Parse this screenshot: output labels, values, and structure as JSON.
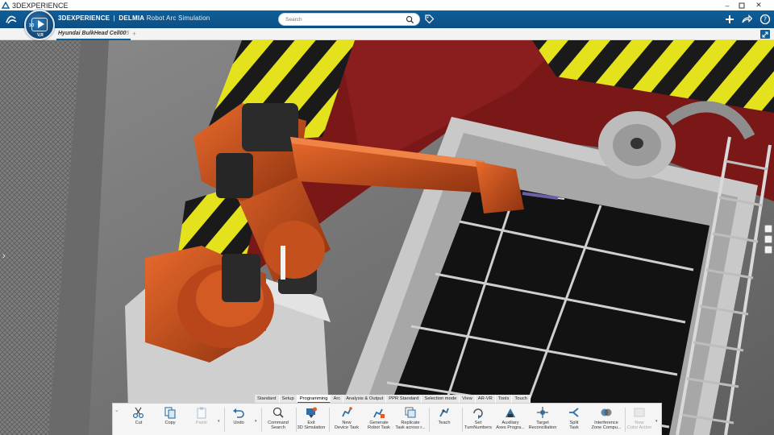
{
  "os_window": {
    "title": "3DEXPERIENCE",
    "controls": [
      "minimize-icon",
      "maximize-icon",
      "close-icon"
    ]
  },
  "header": {
    "brand_prefix": "3D",
    "brand_main": "EXPERIENCE",
    "separator": "|",
    "product": "DELMIA",
    "role": "Robot Arc Simulation",
    "search_placeholder": "Search",
    "icons": [
      "plus-icon",
      "share-icon",
      "help-icon"
    ],
    "accent_color": "#0f5f9a"
  },
  "compass": {
    "label_3d": "3D",
    "label_vr": "V,R"
  },
  "tabs": {
    "active_doc": "Hyundai BulkHead Cell00",
    "active_doc_fade": "5",
    "add_label": "+"
  },
  "ribbon": {
    "tabs": [
      {
        "label": "Standard",
        "active": false
      },
      {
        "label": "Setup",
        "active": false
      },
      {
        "label": "Programming",
        "active": true
      },
      {
        "label": "Arc",
        "active": false
      },
      {
        "label": "Analysis & Output",
        "active": false
      },
      {
        "label": "PPR Standard",
        "active": false
      },
      {
        "label": "Selection mode",
        "active": false
      },
      {
        "label": "View",
        "active": false
      },
      {
        "label": "AR-VR",
        "active": false
      },
      {
        "label": "Tools",
        "active": false
      },
      {
        "label": "Touch",
        "active": false
      }
    ],
    "commands": [
      {
        "label1": "Cut",
        "label2": "",
        "icon": "scissors-icon",
        "enabled": true
      },
      {
        "label1": "Copy",
        "label2": "",
        "icon": "copy-icon",
        "enabled": true
      },
      {
        "label1": "Paste",
        "label2": "",
        "icon": "paste-icon",
        "enabled": false
      },
      {
        "label1": "Undo",
        "label2": "",
        "icon": "undo-icon",
        "enabled": true
      },
      {
        "label1": "Command",
        "label2": "Search",
        "icon": "command-search-icon",
        "enabled": true
      },
      {
        "label1": "Exit",
        "label2": "3D Simulation",
        "icon": "exit-simulation-icon",
        "enabled": true
      },
      {
        "label1": "New",
        "label2": "Device Task",
        "icon": "new-device-task-icon",
        "enabled": true
      },
      {
        "label1": "Generate",
        "label2": "Robot Task",
        "icon": "generate-robot-task-icon",
        "enabled": true
      },
      {
        "label1": "Replicate",
        "label2": "Task across r...",
        "icon": "replicate-task-icon",
        "enabled": true
      },
      {
        "label1": "Teach",
        "label2": "",
        "icon": "teach-icon",
        "enabled": true
      },
      {
        "label1": "Set",
        "label2": "TurnNumbers",
        "icon": "set-turn-numbers-icon",
        "enabled": true
      },
      {
        "label1": "Auxiliary",
        "label2": "Axes Progra...",
        "icon": "auxiliary-axes-icon",
        "enabled": true
      },
      {
        "label1": "Target",
        "label2": "Reconciliation",
        "icon": "target-reconciliation-icon",
        "enabled": true
      },
      {
        "label1": "Split",
        "label2": "Task",
        "icon": "split-task-icon",
        "enabled": true
      },
      {
        "label1": "Interference",
        "label2": "Zone Compu...",
        "icon": "interference-zone-icon",
        "enabled": true
      },
      {
        "label1": "New",
        "label2": "Color Action",
        "icon": "new-color-action-icon",
        "enabled": false
      }
    ]
  }
}
